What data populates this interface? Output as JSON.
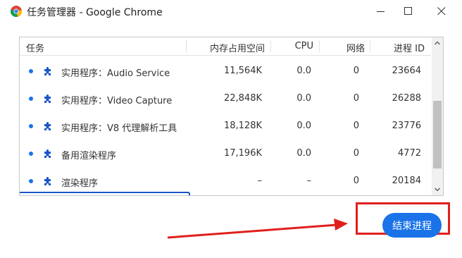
{
  "window": {
    "title": "任务管理器 - Google Chrome",
    "controls": {
      "minimize": "minimize",
      "maximize": "maximize",
      "close": "close"
    }
  },
  "table": {
    "headers": {
      "task": "任务",
      "memory": "内存占用空间",
      "cpu": "CPU",
      "network": "网络",
      "pid": "进程 ID"
    },
    "rows": [
      {
        "name": "实用程序：Audio Service",
        "memory": "11,564K",
        "cpu": "0.0",
        "network": "0",
        "pid": "23664"
      },
      {
        "name": "实用程序：Video Capture",
        "memory": "22,848K",
        "cpu": "0.0",
        "network": "0",
        "pid": "26288"
      },
      {
        "name": "实用程序：V8 代理解析工具",
        "memory": "18,128K",
        "cpu": "0.0",
        "network": "0",
        "pid": "23776"
      },
      {
        "name": "备用渲染程序",
        "memory": "17,196K",
        "cpu": "0.0",
        "network": "0",
        "pid": "4772"
      },
      {
        "name": "渲染程序",
        "memory": "–",
        "cpu": "–",
        "network": "0",
        "pid": "20184"
      }
    ]
  },
  "footer": {
    "end_process_label": "结束进程"
  },
  "colors": {
    "accent": "#1a73e8",
    "annotation_red": "#e0201e",
    "status_dot": "#1a73e8"
  },
  "icons": {
    "app": "chrome-logo-icon",
    "row": "puzzle-piece-icon"
  }
}
